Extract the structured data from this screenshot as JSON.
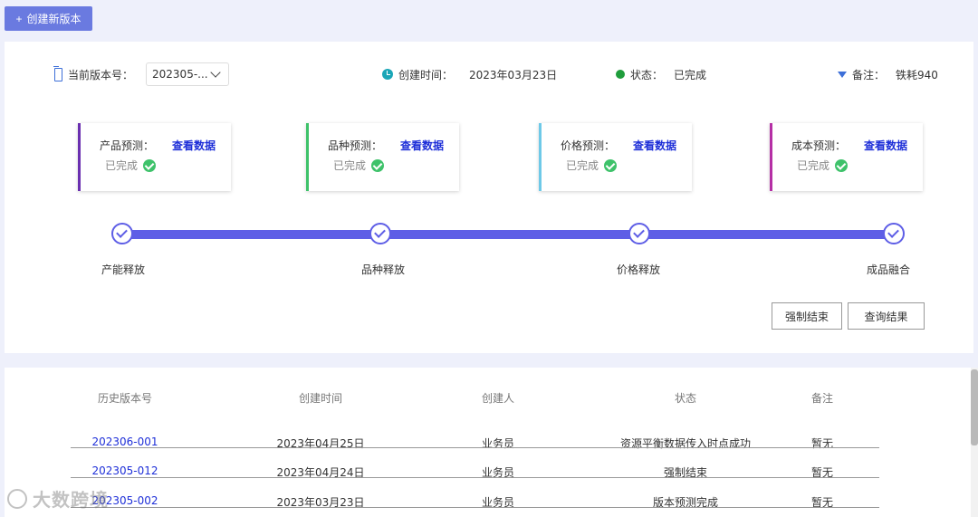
{
  "toolbar": {
    "create_label": "创建新版本",
    "create_icon": "plus-icon"
  },
  "info": {
    "version_label": "当前版本号：",
    "version_value": "202305-...",
    "created_label": "创建时间：",
    "created_value": "2023年03月23日",
    "status_label": "状态：",
    "status_value": "已完成",
    "note_label": "备注：",
    "note_value": "铁耗940"
  },
  "cards": [
    {
      "title": "产品预测：",
      "link": "查看数据",
      "status": "已完成",
      "color": "#6a2fb0"
    },
    {
      "title": "品种预测：",
      "link": "查看数据",
      "status": "已完成",
      "color": "#3ec26a"
    },
    {
      "title": "价格预测：",
      "link": "查看数据",
      "status": "已完成",
      "color": "#6ec9e8"
    },
    {
      "title": "成本预测：",
      "link": "查看数据",
      "status": "已完成",
      "color": "#b52fa5"
    }
  ],
  "steps": [
    "产能释放",
    "品种释放",
    "价格释放",
    "成品融合"
  ],
  "actions": {
    "force_end": "强制结束",
    "query_result": "查询结果"
  },
  "history": {
    "headers": [
      "历史版本号",
      "创建时间",
      "创建人",
      "状态",
      "备注"
    ],
    "rows": [
      [
        "202306-001",
        "2023年04月25日",
        "业务员",
        "资源平衡数据传入时点成功",
        "暂无"
      ],
      [
        "202305-012",
        "2023年04月24日",
        "业务员",
        "强制结束",
        "暂无"
      ],
      [
        "202305-002",
        "2023年03月23日",
        "业务员",
        "版本预测完成",
        "暂无"
      ]
    ]
  },
  "watermark": "大数跨境",
  "colors": {
    "accent": "#5e5ee6",
    "link": "#1e2fd8",
    "button": "#6a7ae0"
  }
}
